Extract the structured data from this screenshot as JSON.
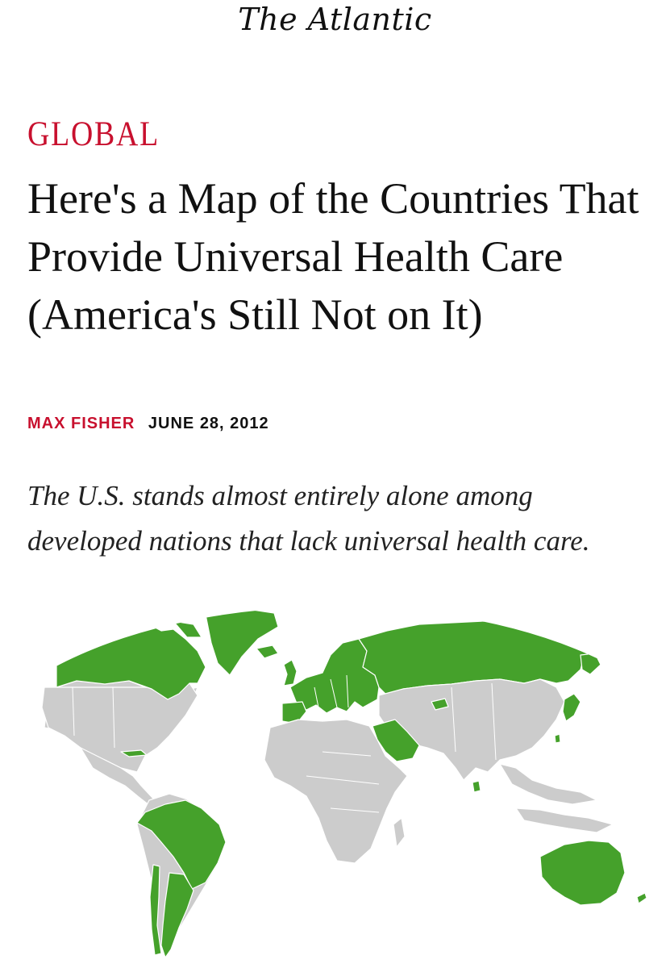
{
  "masthead": {
    "title": "The Atlantic"
  },
  "article": {
    "section": "Global",
    "headline": "Here's a Map of the Countries That Provide Universal Health Care (America's Still Not on It)",
    "author": "Max Fisher",
    "date": "June 28, 2012",
    "dek": "The U.S. stands almost entirely alone among developed nations that lack universal health care."
  },
  "map": {
    "colors": {
      "universal": "#45a12b",
      "other": "#cccccc",
      "border": "#ffffff"
    },
    "highlighted_regions": [
      "Canada",
      "Greenland",
      "Europe",
      "Russia",
      "Japan",
      "Saudi Arabia",
      "Brazil",
      "Argentina",
      "Chile",
      "Uruguay",
      "Australia",
      "New Zealand",
      "Cuba",
      "Sri Lanka",
      "Georgia",
      "Taiwan"
    ]
  }
}
